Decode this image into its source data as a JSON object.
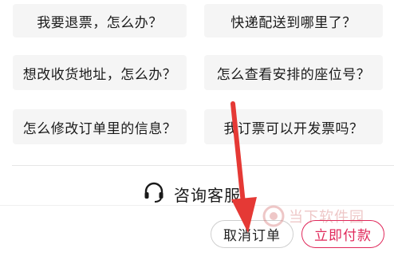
{
  "faq": {
    "q1": "我要退票，怎么办？",
    "q2": "快递配送到哪里了？",
    "q3": "想改收货地址，怎么办？",
    "q4": "怎么查看安排的座位号？",
    "q5": "怎么修改订单里的信息？",
    "q6": "我订票可以开发票吗？"
  },
  "service": {
    "label": "咨询客服",
    "icon": "headset-icon"
  },
  "footer": {
    "cancel_label": "取消订单",
    "pay_label": "立即付款"
  },
  "watermark": {
    "text": "当下软件园"
  },
  "colors": {
    "accent": "#e0285a",
    "arrow": "#e53935"
  }
}
